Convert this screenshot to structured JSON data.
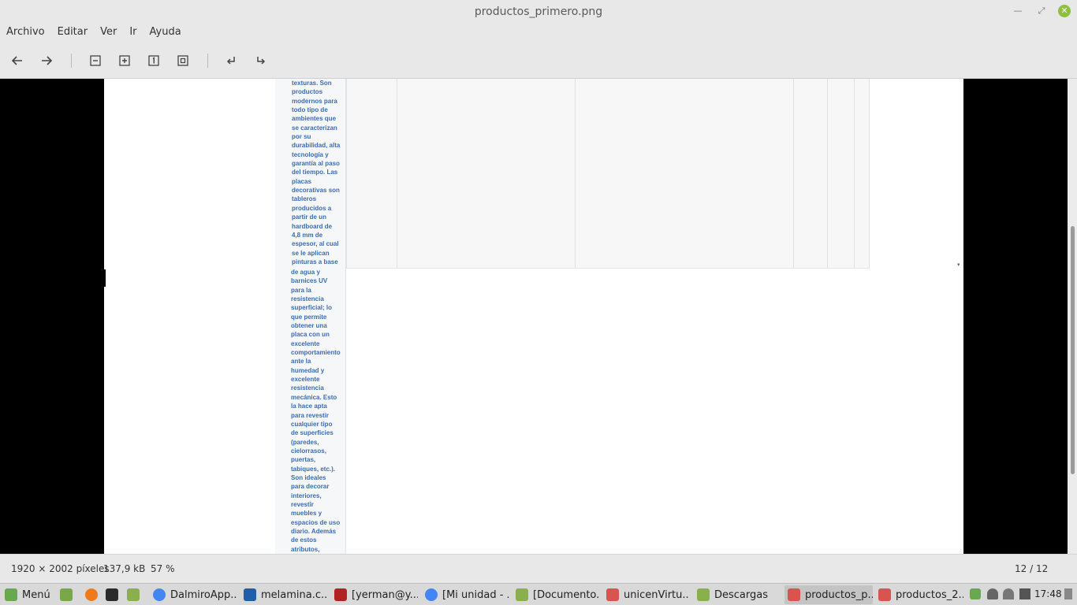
{
  "window": {
    "title": "productos_primero.png"
  },
  "menu": [
    "Archivo",
    "Editar",
    "Ver",
    "Ir",
    "Ayuda"
  ],
  "toolbar_icons": [
    "arrow-left-icon",
    "arrow-right-icon",
    "zoom-out-icon",
    "zoom-in-icon",
    "zoom-normal-icon",
    "zoom-fit-icon",
    "rotate-left-icon",
    "rotate-right-icon"
  ],
  "image_text": {
    "upper": "texturas. Son\nproductos\nmodernos para\ntodo tipo de\nambientes que\nse caracterizan\npor su\ndurabilidad, alta\ntecnología y\ngarantía al paso\ndel tiempo. Las\nplacas\ndecorativas son\ntableros\nproducidos a\npartir de un\nhardboard de\n4,8 mm de\nespesor, al cual\nse le aplican\npinturas a base",
    "lower": "de agua y\nbarnices UV\npara la\nresistencia\nsuperficial; lo\nque permite\nobtener una\nplaca con un\nexcelente\ncomportamiento\nante la\nhumedad y\nexcelente\nresistencia\nmecánica. Esto\nla hace apta\npara revestir\ncualquier tipo\nde superficies\n(paredes,\ncielorrasos,\npuertas,\ntabiques, etc.).\nSon ideales\npara decorar\ninteriores,\nrevestir\nmuebles y\nespacios de uso\ndiario. Además\nde estos\natributos,"
  },
  "status": {
    "dimensions": "1920 × 2002 píxeles",
    "size": "137,9 kB",
    "zoom": "57 %",
    "position": "12 / 12"
  },
  "taskbar": {
    "menu_label": "Menú",
    "items": [
      "DalmiroApp...",
      "melamina.c...",
      "[yerman@y...",
      "[Mi unidad - ...",
      "[Documento...",
      "unicenVirtu...",
      "Descargas",
      "productos_p...",
      "productos_2..."
    ],
    "clock": "17:48"
  },
  "colors": {
    "accent": "#8fbf3f",
    "link_text": "#3a6cb8"
  }
}
